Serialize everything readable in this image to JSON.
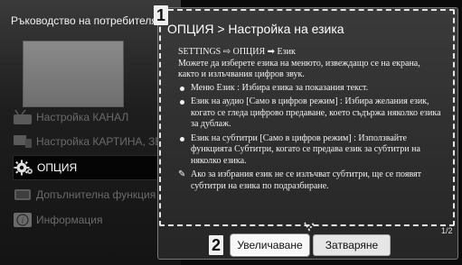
{
  "guide": {
    "title": "Ръководство на потребителя",
    "menu": [
      {
        "label": "Настройка КАНАЛ",
        "icon": "antenna-icon"
      },
      {
        "label": "Настройка КАРТИНА, ЗВУК",
        "icon": "picture-sound-icon"
      },
      {
        "label": "ОПЦИЯ",
        "icon": "gear-icon",
        "active": true
      },
      {
        "label": "Допълнителна функция",
        "icon": "extra-function-icon"
      },
      {
        "label": "Информация",
        "icon": "info-icon"
      }
    ]
  },
  "dialog": {
    "badge1": "1",
    "badge2": "2",
    "title": "ОПЦИЯ > Настройка на езика",
    "path": "SETTINGS ⇨ ОПЦИЯ ➡ Език",
    "intro": "Можете да изберете езика на менюто, извеждащо се на екрана, както и излъчвания цифров звук.",
    "bullets": [
      "Меню Език : Избира езика за показания текст.",
      "Език на аудио [Само в цифров режим] : Избира желания език, когато се гледа цифрово предаване, което съдържа няколко езика за дублаж.",
      "Език на субтитри [Само в цифров режим] : Използвайте функцията Субтитри, когато се предава език за субтитри на няколко езика."
    ],
    "note": "Ако за избрания език не се излъчват субтитри, ще се появят субтитри на езика по подразбиране.",
    "page_indicator": "1/2",
    "zoom_button": "Увеличаване",
    "close_button": "Затваряне"
  }
}
